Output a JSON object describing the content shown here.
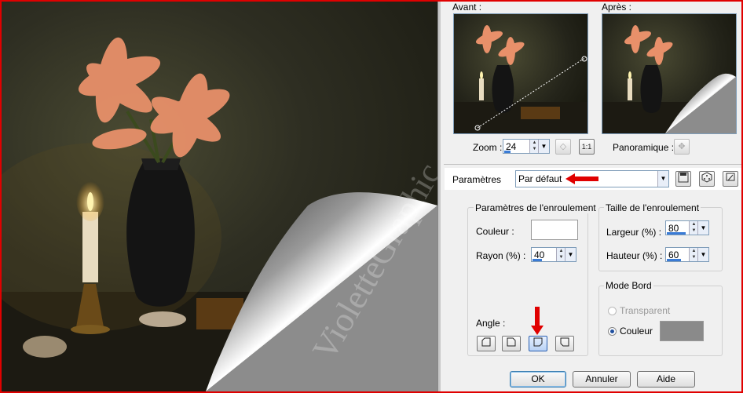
{
  "preview": {
    "watermark": "VioletteGraphic"
  },
  "labels": {
    "avant": "Avant :",
    "apres": "Après :",
    "zoom": "Zoom :",
    "panoramique": "Panoramique :",
    "parametres": "Paramètres",
    "group_enroulement": "Paramètres de l'enroulement",
    "couleur": "Couleur :",
    "rayon": "Rayon (%) :",
    "angle": "Angle :",
    "group_taille": "Taille de l'enroulement",
    "largeur": "Largeur (%) :",
    "hauteur": "Hauteur (%) :",
    "group_bord": "Mode Bord",
    "transparent": "Transparent",
    "couleur_bord": "Couleur"
  },
  "values": {
    "zoom": "24",
    "preset": "Par défaut",
    "rayon": "40",
    "largeur": "80",
    "hauteur": "60",
    "couleur_swatch": "#ffffff",
    "bord_swatch": "#8a8a8a",
    "rayon_fraction": 0.4,
    "largeur_fraction": 0.8,
    "hauteur_fraction": 0.6,
    "zoom_fraction": 0.24
  },
  "buttons": {
    "ok": "OK",
    "annuler": "Annuler",
    "aide": "Aide",
    "zoom_actual": "1:1"
  },
  "colors": {
    "accent_red": "#e00000",
    "frame_border": "#e00000"
  },
  "icons": {
    "save": "save-icon",
    "random": "dice-icon",
    "reset": "reset-icon",
    "pan": "move-icon",
    "fit": "fit-icon"
  }
}
